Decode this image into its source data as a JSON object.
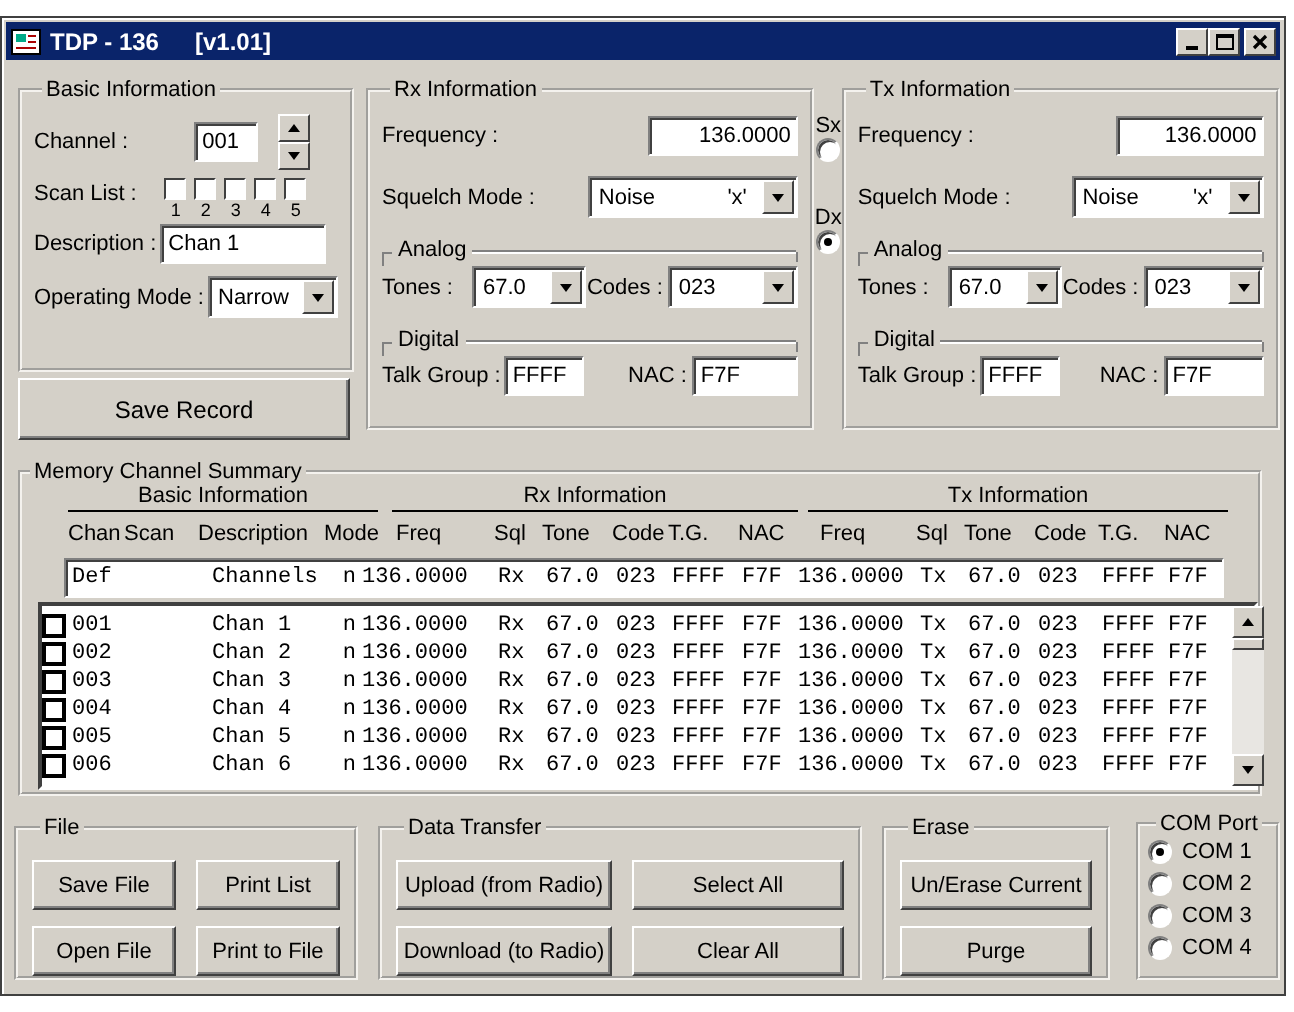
{
  "window": {
    "title": "TDP - 136",
    "version": "[v1.01]"
  },
  "basic": {
    "title": "Basic Information",
    "channel_label": "Channel :",
    "channel": "001",
    "scan_label": "Scan List :",
    "scan": [
      {
        "label": "1",
        "checked": false
      },
      {
        "label": "2",
        "checked": false
      },
      {
        "label": "3",
        "checked": false
      },
      {
        "label": "4",
        "checked": false
      },
      {
        "label": "5",
        "checked": false
      }
    ],
    "description_label": "Description :",
    "description": "Chan 1",
    "mode_label": "Operating Mode :",
    "mode": "Narrow"
  },
  "save_button": "Save Record",
  "rx": {
    "title": "Rx Information",
    "frequency_label": "Frequency :",
    "frequency": "136.0000",
    "squelch_label": "Squelch Mode :",
    "squelch": "Noise",
    "squelch_code": "'x'",
    "analog_title": "Analog",
    "tones_label": "Tones :",
    "tones": "67.0",
    "codes_label": "Codes :",
    "codes": "023",
    "digital_title": "Digital",
    "talk_group_label": "Talk Group :",
    "talk_group": "FFFF",
    "nac_label": "NAC :",
    "nac": "F7F"
  },
  "duplex": [
    {
      "label": "Sx",
      "selected": false
    },
    {
      "label": "Dx",
      "selected": true
    }
  ],
  "tx": {
    "title": "Tx Information",
    "frequency_label": "Frequency :",
    "frequency": "136.0000",
    "squelch_label": "Squelch Mode :",
    "squelch": "Noise",
    "squelch_code": "'x'",
    "analog_title": "Analog",
    "tones_label": "Tones :",
    "tones": "67.0",
    "codes_label": "Codes :",
    "codes": "023",
    "digital_title": "Digital",
    "talk_group_label": "Talk Group :",
    "talk_group": "FFFF",
    "nac_label": "NAC :",
    "nac": "F7F"
  },
  "summary": {
    "title": "Memory Channel Summary",
    "groups": [
      "Basic Information",
      "Rx Information",
      "Tx Information"
    ],
    "columns": [
      "Chan",
      "Scan",
      "Description",
      "Mode",
      "Freq",
      "Sql",
      "Tone",
      "Code",
      "T.G.",
      "NAC",
      "Freq",
      "Sql",
      "Tone",
      "Code",
      "T.G.",
      "NAC"
    ],
    "default_row": {
      "chan": "Def",
      "description": "Channels",
      "mode": "n",
      "rx": [
        "136.0000",
        "Rx",
        "67.0",
        "023",
        "FFFF",
        "F7F"
      ],
      "tx": [
        "136.0000",
        "Tx",
        "67.0",
        "023",
        "FFFF",
        "F7F"
      ]
    },
    "rows": [
      {
        "checked": false,
        "chan": "001",
        "description": "Chan 1",
        "mode": "n",
        "rx": [
          "136.0000",
          "Rx",
          "67.0",
          "023",
          "FFFF",
          "F7F"
        ],
        "tx": [
          "136.0000",
          "Tx",
          "67.0",
          "023",
          "FFFF",
          "F7F"
        ]
      },
      {
        "checked": false,
        "chan": "002",
        "description": "Chan 2",
        "mode": "n",
        "rx": [
          "136.0000",
          "Rx",
          "67.0",
          "023",
          "FFFF",
          "F7F"
        ],
        "tx": [
          "136.0000",
          "Tx",
          "67.0",
          "023",
          "FFFF",
          "F7F"
        ]
      },
      {
        "checked": false,
        "chan": "003",
        "description": "Chan 3",
        "mode": "n",
        "rx": [
          "136.0000",
          "Rx",
          "67.0",
          "023",
          "FFFF",
          "F7F"
        ],
        "tx": [
          "136.0000",
          "Tx",
          "67.0",
          "023",
          "FFFF",
          "F7F"
        ]
      },
      {
        "checked": false,
        "chan": "004",
        "description": "Chan 4",
        "mode": "n",
        "rx": [
          "136.0000",
          "Rx",
          "67.0",
          "023",
          "FFFF",
          "F7F"
        ],
        "tx": [
          "136.0000",
          "Tx",
          "67.0",
          "023",
          "FFFF",
          "F7F"
        ]
      },
      {
        "checked": false,
        "chan": "005",
        "description": "Chan 5",
        "mode": "n",
        "rx": [
          "136.0000",
          "Rx",
          "67.0",
          "023",
          "FFFF",
          "F7F"
        ],
        "tx": [
          "136.0000",
          "Tx",
          "67.0",
          "023",
          "FFFF",
          "F7F"
        ]
      },
      {
        "checked": false,
        "chan": "006",
        "description": "Chan 6",
        "mode": "n",
        "rx": [
          "136.0000",
          "Rx",
          "67.0",
          "023",
          "FFFF",
          "F7F"
        ],
        "tx": [
          "136.0000",
          "Tx",
          "67.0",
          "023",
          "FFFF",
          "F7F"
        ]
      }
    ]
  },
  "file": {
    "title": "File",
    "buttons": [
      "Save File",
      "Print List",
      "Open File",
      "Print to File"
    ]
  },
  "data_transfer": {
    "title": "Data Transfer",
    "buttons": [
      "Upload (from Radio)",
      "Select All",
      "Download (to Radio)",
      "Clear All"
    ]
  },
  "erase": {
    "title": "Erase",
    "buttons": [
      "Un/Erase Current",
      "Purge"
    ]
  },
  "com_port": {
    "title": "COM Port",
    "options": [
      {
        "label": "COM 1",
        "selected": true
      },
      {
        "label": "COM 2",
        "selected": false
      },
      {
        "label": "COM 3",
        "selected": false
      },
      {
        "label": "COM 4",
        "selected": false
      }
    ]
  }
}
